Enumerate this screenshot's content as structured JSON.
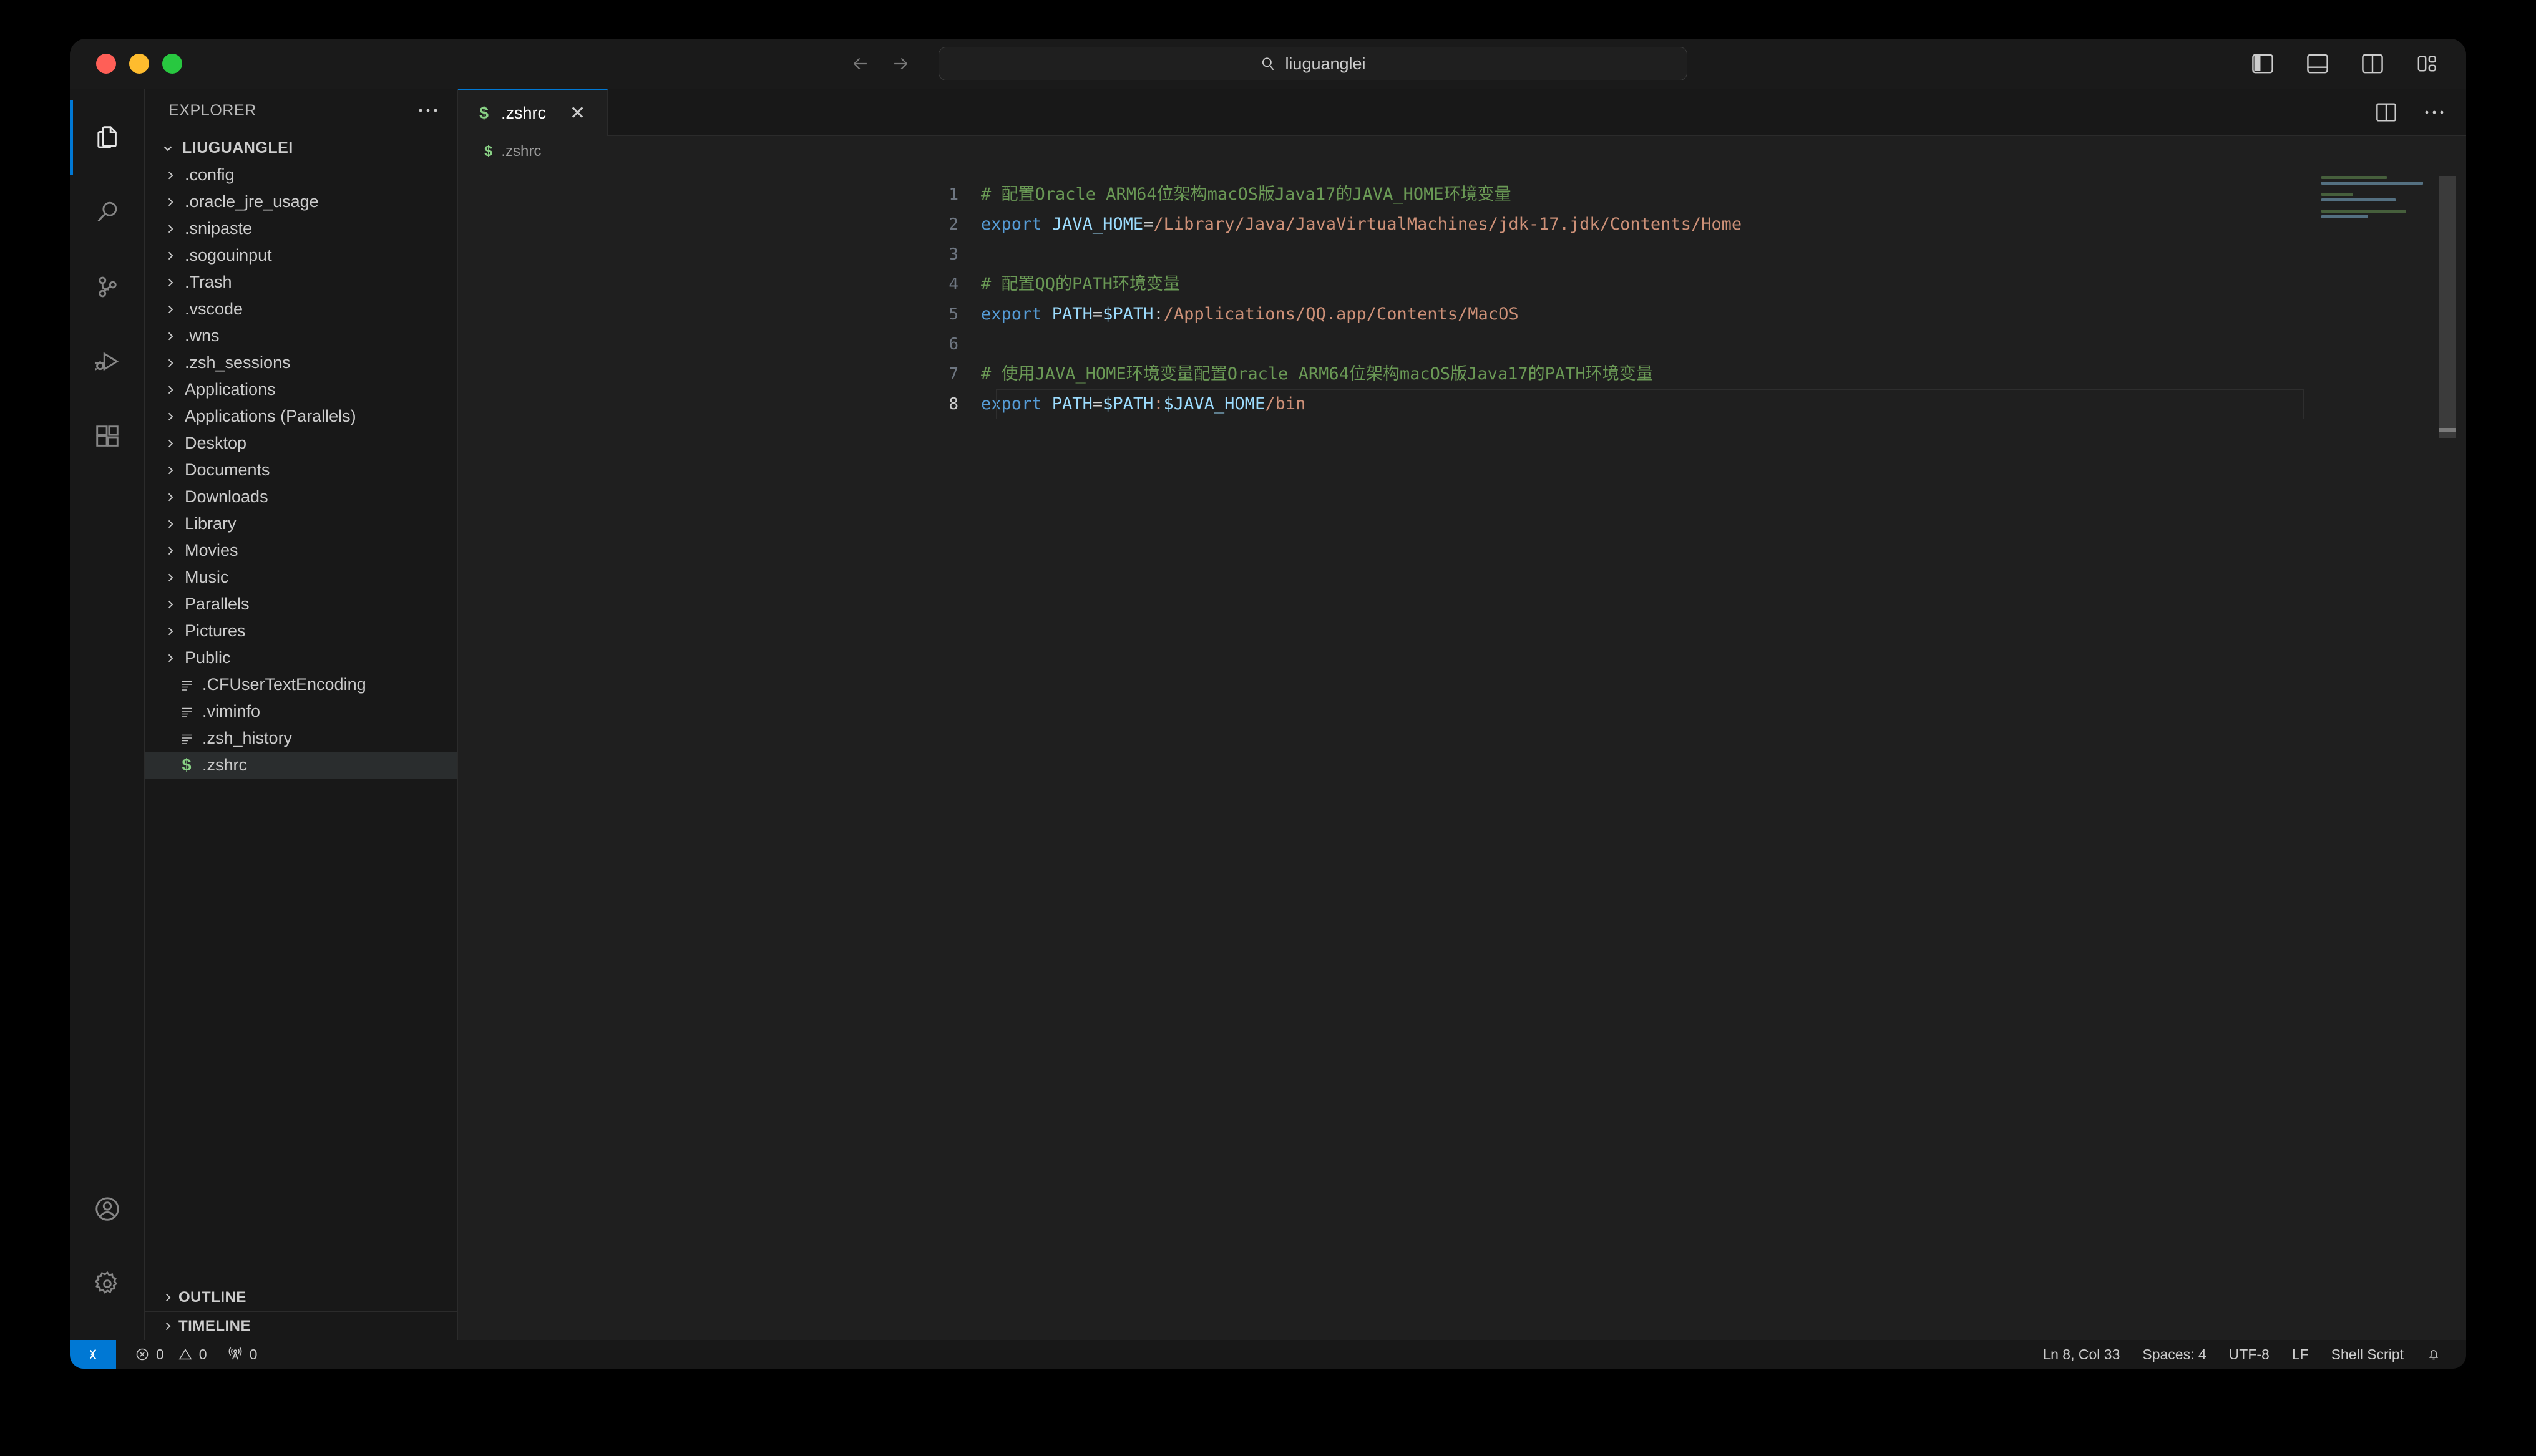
{
  "window": {
    "traffic_lights": [
      "close",
      "minimize",
      "maximize"
    ],
    "colors": {
      "close": "#ff5f57",
      "minimize": "#febc2e",
      "maximize": "#28c840",
      "accent": "#0078d4",
      "tab_active_border": "#0078d4"
    }
  },
  "titlebar": {
    "back_icon": "arrow-left-icon",
    "forward_icon": "arrow-right-icon",
    "command_center": {
      "icon": "search-icon",
      "value": "liuguanglei",
      "placeholder": "Search"
    },
    "layout_buttons": [
      {
        "name": "toggle-primary-sidebar",
        "label": "Toggle Primary Side Bar"
      },
      {
        "name": "toggle-panel",
        "label": "Toggle Panel"
      },
      {
        "name": "toggle-secondary-sidebar",
        "label": "Toggle Secondary Side Bar"
      },
      {
        "name": "customize-layout",
        "label": "Customize Layout"
      }
    ]
  },
  "activitybar": {
    "top": [
      {
        "name": "explorer",
        "label": "Explorer",
        "active": true
      },
      {
        "name": "search",
        "label": "Search",
        "active": false
      },
      {
        "name": "source-control",
        "label": "Source Control",
        "active": false
      },
      {
        "name": "run-debug",
        "label": "Run and Debug",
        "active": false
      },
      {
        "name": "extensions",
        "label": "Extensions",
        "active": false
      }
    ],
    "bottom": [
      {
        "name": "accounts",
        "label": "Accounts"
      },
      {
        "name": "settings",
        "label": "Manage"
      }
    ]
  },
  "sidebar": {
    "header": {
      "title": "EXPLORER",
      "more_label": "Views and More Actions..."
    },
    "root": {
      "label": "LIUGUANGLEI",
      "expanded": true
    },
    "items": [
      {
        "label": ".config",
        "type": "folder",
        "expanded": false
      },
      {
        "label": ".oracle_jre_usage",
        "type": "folder",
        "expanded": false
      },
      {
        "label": ".snipaste",
        "type": "folder",
        "expanded": false
      },
      {
        "label": ".sogouinput",
        "type": "folder",
        "expanded": false
      },
      {
        "label": ".Trash",
        "type": "folder",
        "expanded": false
      },
      {
        "label": ".vscode",
        "type": "folder",
        "expanded": false
      },
      {
        "label": ".wns",
        "type": "folder",
        "expanded": false
      },
      {
        "label": ".zsh_sessions",
        "type": "folder",
        "expanded": false
      },
      {
        "label": "Applications",
        "type": "folder",
        "expanded": false
      },
      {
        "label": "Applications (Parallels)",
        "type": "folder",
        "expanded": false
      },
      {
        "label": "Desktop",
        "type": "folder",
        "expanded": false
      },
      {
        "label": "Documents",
        "type": "folder",
        "expanded": false
      },
      {
        "label": "Downloads",
        "type": "folder",
        "expanded": false
      },
      {
        "label": "Library",
        "type": "folder",
        "expanded": false
      },
      {
        "label": "Movies",
        "type": "folder",
        "expanded": false
      },
      {
        "label": "Music",
        "type": "folder",
        "expanded": false
      },
      {
        "label": "Parallels",
        "type": "folder",
        "expanded": false
      },
      {
        "label": "Pictures",
        "type": "folder",
        "expanded": false
      },
      {
        "label": "Public",
        "type": "folder",
        "expanded": false
      },
      {
        "label": ".CFUserTextEncoding",
        "type": "file",
        "icon": "text-file-icon",
        "selected": false
      },
      {
        "label": ".viminfo",
        "type": "file",
        "icon": "text-file-icon",
        "selected": false
      },
      {
        "label": ".zsh_history",
        "type": "file",
        "icon": "text-file-icon",
        "selected": false
      },
      {
        "label": ".zshrc",
        "type": "file",
        "icon": "shell-file-icon",
        "selected": true
      }
    ],
    "sections": [
      {
        "label": "OUTLINE",
        "expanded": false
      },
      {
        "label": "TIMELINE",
        "expanded": false
      }
    ]
  },
  "editor": {
    "tabs": [
      {
        "label": ".zshrc",
        "icon": "shell-file-icon",
        "active": true,
        "close_icon": "close-icon"
      }
    ],
    "actions": [
      {
        "name": "split-editor-right",
        "label": "Split Editor Right"
      },
      {
        "name": "more-actions",
        "label": "More Actions..."
      }
    ],
    "breadcrumb": {
      "icon": "shell-file-icon",
      "label": ".zshrc"
    },
    "lines": [
      {
        "number": "1",
        "current": false,
        "tokens": [
          {
            "t": "# 配置Oracle ARM64位架构macOS版Java17的JAVA_HOME环境变量",
            "c": "c-comment"
          }
        ]
      },
      {
        "number": "2",
        "current": false,
        "tokens": [
          {
            "t": "export ",
            "c": "c-kw"
          },
          {
            "t": "JAVA_HOME",
            "c": "c-var"
          },
          {
            "t": "=",
            "c": "c-op"
          },
          {
            "t": "/Library/Java/JavaVirtualMachines/jdk-17.jdk/Contents/Home",
            "c": "c-str"
          }
        ]
      },
      {
        "number": "3",
        "current": false,
        "tokens": [
          {
            "t": "",
            "c": "ltext"
          }
        ]
      },
      {
        "number": "4",
        "current": false,
        "tokens": [
          {
            "t": "# 配置QQ的PATH环境变量",
            "c": "c-comment"
          }
        ]
      },
      {
        "number": "5",
        "current": false,
        "tokens": [
          {
            "t": "export ",
            "c": "c-kw"
          },
          {
            "t": "PATH",
            "c": "c-var"
          },
          {
            "t": "=",
            "c": "c-op"
          },
          {
            "t": "$PATH",
            "c": "c-var"
          },
          {
            "t": ":",
            "c": "c-op"
          },
          {
            "t": "/Applications/QQ.app/Contents/MacOS",
            "c": "c-str"
          }
        ]
      },
      {
        "number": "6",
        "current": false,
        "tokens": [
          {
            "t": "",
            "c": "ltext"
          }
        ]
      },
      {
        "number": "7",
        "current": false,
        "tokens": [
          {
            "t": "# 使用JAVA_HOME环境变量配置Oracle ARM64位架构macOS版Java17的PATH环境变量",
            "c": "c-comment"
          }
        ]
      },
      {
        "number": "8",
        "current": true,
        "tokens": [
          {
            "t": "export ",
            "c": "c-kw"
          },
          {
            "t": "PATH",
            "c": "c-var"
          },
          {
            "t": "=",
            "c": "c-op"
          },
          {
            "t": "$PATH",
            "c": "c-var"
          },
          {
            "t": ":",
            "c": "c-str"
          },
          {
            "t": "$JAVA_HOME",
            "c": "c-var"
          },
          {
            "t": "/bin",
            "c": "c-str"
          }
        ]
      }
    ],
    "minimap": [
      {
        "w": 62,
        "color": "#4d6b42"
      },
      {
        "w": 96,
        "color": "#5e7f93"
      },
      {
        "w": 0,
        "color": "transparent"
      },
      {
        "w": 30,
        "color": "#4d6b42"
      },
      {
        "w": 70,
        "color": "#5e7f93"
      },
      {
        "w": 0,
        "color": "transparent"
      },
      {
        "w": 80,
        "color": "#4d6b42"
      },
      {
        "w": 44,
        "color": "#5e7f93"
      }
    ]
  },
  "statusbar": {
    "remote": {
      "icon": "remote-indicator-icon",
      "label": ""
    },
    "left": [
      {
        "name": "errors",
        "icon": "error-icon",
        "value": "0"
      },
      {
        "name": "warnings",
        "icon": "warning-icon",
        "value": "0"
      },
      {
        "name": "ports",
        "icon": "radio-tower-icon",
        "value": "0"
      }
    ],
    "right": [
      {
        "name": "cursor-position",
        "label": "Ln 8, Col 33"
      },
      {
        "name": "indentation",
        "label": "Spaces: 4"
      },
      {
        "name": "encoding",
        "label": "UTF-8"
      },
      {
        "name": "eol",
        "label": "LF"
      },
      {
        "name": "language-mode",
        "label": "Shell Script"
      }
    ],
    "bell": {
      "name": "notifications-bell-icon"
    }
  }
}
